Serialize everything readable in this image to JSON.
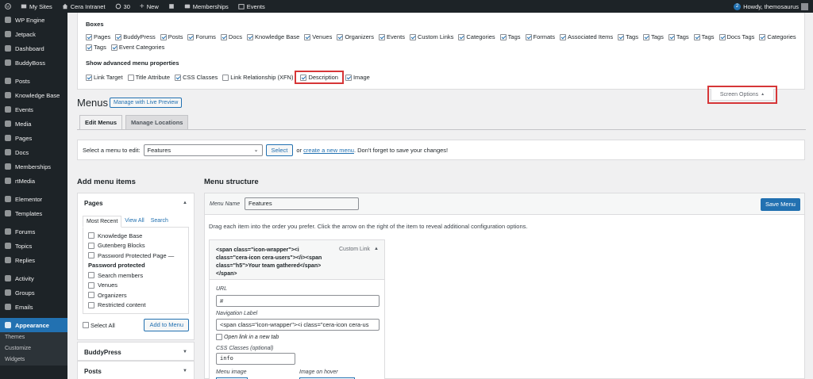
{
  "adminbar": {
    "my_sites": "My Sites",
    "site_name": "Cera Intranet",
    "updates_count": "30",
    "new_label": "New",
    "memberships": "Memberships",
    "events": "Events",
    "notif_count": "2",
    "howdy": "Howdy, themosaurus"
  },
  "sidebar": {
    "items": [
      {
        "label": "WP Engine",
        "icon": "wpengine-icon"
      },
      {
        "label": "Jetpack",
        "icon": "jetpack-icon"
      },
      {
        "label": "Dashboard",
        "icon": "dashboard-icon"
      },
      {
        "label": "BuddyBoss",
        "icon": "buddyboss-icon"
      },
      {
        "label": "Posts",
        "icon": "pin-icon"
      },
      {
        "label": "Knowledge Base",
        "icon": "knowledge-icon"
      },
      {
        "label": "Events",
        "icon": "calendar-icon"
      },
      {
        "label": "Media",
        "icon": "media-icon"
      },
      {
        "label": "Pages",
        "icon": "pages-icon"
      },
      {
        "label": "Docs",
        "icon": "pin-icon"
      },
      {
        "label": "Memberships",
        "icon": "memberships-icon"
      },
      {
        "label": "rtMedia",
        "icon": "rtmedia-icon"
      },
      {
        "label": "Elementor",
        "icon": "elementor-icon"
      },
      {
        "label": "Templates",
        "icon": "templates-icon"
      },
      {
        "label": "Forums",
        "icon": "forums-icon"
      },
      {
        "label": "Topics",
        "icon": "topics-icon"
      },
      {
        "label": "Replies",
        "icon": "replies-icon"
      },
      {
        "label": "Activity",
        "icon": "activity-icon"
      },
      {
        "label": "Groups",
        "icon": "groups-icon"
      },
      {
        "label": "Emails",
        "icon": "emails-icon"
      },
      {
        "label": "Appearance",
        "icon": "appearance-icon"
      }
    ],
    "submenu": [
      "Themes",
      "Customize",
      "Widgets"
    ]
  },
  "screen_options": {
    "boxes_heading": "Boxes",
    "boxes": [
      {
        "label": "Pages",
        "checked": true
      },
      {
        "label": "BuddyPress",
        "checked": true
      },
      {
        "label": "Posts",
        "checked": true
      },
      {
        "label": "Forums",
        "checked": true
      },
      {
        "label": "Docs",
        "checked": true
      },
      {
        "label": "Knowledge Base",
        "checked": true
      },
      {
        "label": "Venues",
        "checked": true
      },
      {
        "label": "Organizers",
        "checked": true
      },
      {
        "label": "Events",
        "checked": true
      },
      {
        "label": "Custom Links",
        "checked": true
      },
      {
        "label": "Categories",
        "checked": true
      },
      {
        "label": "Tags",
        "checked": true
      },
      {
        "label": "Formats",
        "checked": true
      },
      {
        "label": "Associated Items",
        "checked": true
      },
      {
        "label": "Tags",
        "checked": true
      },
      {
        "label": "Tags",
        "checked": true
      },
      {
        "label": "Tags",
        "checked": true
      },
      {
        "label": "Tags",
        "checked": true
      },
      {
        "label": "Docs Tags",
        "checked": true
      },
      {
        "label": "Categories",
        "checked": true
      },
      {
        "label": "Tags",
        "checked": true
      },
      {
        "label": "Event Categories",
        "checked": true
      }
    ],
    "advanced_heading": "Show advanced menu properties",
    "advanced": [
      {
        "label": "Link Target",
        "checked": true
      },
      {
        "label": "Title Attribute",
        "checked": false
      },
      {
        "label": "CSS Classes",
        "checked": true
      },
      {
        "label": "Link Relationship (XFN)",
        "checked": false
      },
      {
        "label": "Description",
        "checked": true
      },
      {
        "label": "Image",
        "checked": true
      }
    ],
    "toggle_label": "Screen Options"
  },
  "page": {
    "title": "Menus",
    "preview_button": "Manage with Live Preview",
    "tabs": [
      "Edit Menus",
      "Manage Locations"
    ]
  },
  "select_menu": {
    "label": "Select a menu to edit:",
    "value": "Features",
    "select_button": "Select",
    "or_text": "or",
    "create_link": "create a new menu",
    "tail_text": ". Don't forget to save your changes!"
  },
  "add_items": {
    "title": "Add menu items",
    "pages_heading": "Pages",
    "subtabs": [
      "Most Recent",
      "View All",
      "Search"
    ],
    "pages": [
      {
        "type": "item",
        "label": "Knowledge Base"
      },
      {
        "type": "item",
        "label": "Gutenberg Blocks"
      },
      {
        "type": "item",
        "label": "Password Protected Page —"
      },
      {
        "type": "heading",
        "label": "Password protected"
      },
      {
        "type": "item",
        "label": "Search members"
      },
      {
        "type": "item",
        "label": "Venues"
      },
      {
        "type": "item",
        "label": "Organizers"
      },
      {
        "type": "item",
        "label": "Restricted content"
      }
    ],
    "select_all": "Select All",
    "add_button": "Add to Menu",
    "buddypress_heading": "BuddyPress",
    "posts_heading": "Posts"
  },
  "structure": {
    "title": "Menu structure",
    "name_label": "Menu Name",
    "name_value": "Features",
    "save_button": "Save Menu",
    "help": "Drag each item into the order you prefer. Click the arrow on the right of the item to reveal additional configuration options.",
    "item": {
      "title": "<span class=\"icon-wrapper\"><i class=\"cera-icon cera-users\"></i><span class=\"h5\">Your team gathered</span></span>",
      "type": "Custom Link",
      "url_label": "URL",
      "url_value": "#",
      "nav_label": "Navigation Label",
      "nav_value": "<span class=\"icon-wrapper\"><i class=\"cera-icon cera-us",
      "new_tab": "Open link in a new tab",
      "css_label": "CSS Classes (optional)",
      "css_value": "info",
      "image_label": "Menu image",
      "hover_label": "Image on hover"
    }
  },
  "colors": {
    "accent": "#2271b1",
    "highlight": "#d63638",
    "adminbar": "#1d2327"
  }
}
